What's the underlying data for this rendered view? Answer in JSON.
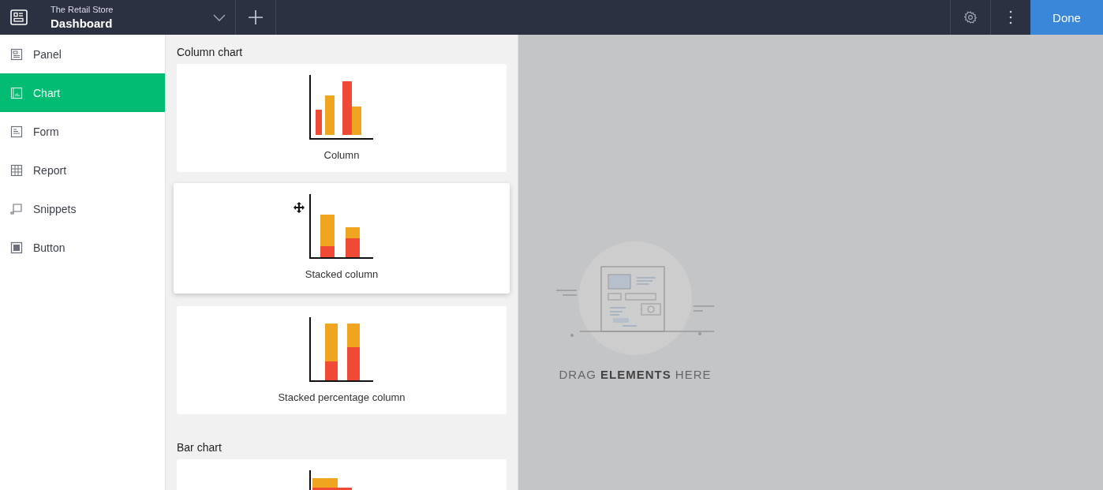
{
  "header": {
    "app_name": "The Retail Store",
    "page_title": "Dashboard"
  },
  "done_button": "Done",
  "sidebar": {
    "items": [
      {
        "kind": "panel",
        "label": "Panel",
        "selected": false
      },
      {
        "kind": "chart",
        "label": "Chart",
        "selected": true
      },
      {
        "kind": "form",
        "label": "Form",
        "selected": false
      },
      {
        "kind": "report",
        "label": "Report",
        "selected": false
      },
      {
        "kind": "snippets",
        "label": "Snippets",
        "selected": false
      },
      {
        "kind": "button",
        "label": "Button",
        "selected": false
      }
    ]
  },
  "sections": [
    {
      "title": "Column chart",
      "cards": [
        {
          "kind": "column",
          "label": "Column",
          "hovered": false
        },
        {
          "kind": "stacked",
          "label": "Stacked column",
          "hovered": true
        },
        {
          "kind": "percent",
          "label": "Stacked percentage column",
          "hovered": false
        }
      ]
    },
    {
      "title": "Bar chart",
      "cards": [
        {
          "kind": "bar",
          "hovered": false
        }
      ]
    }
  ],
  "drop_zone": {
    "text": "DRAG **ELEMENTS** HERE"
  }
}
